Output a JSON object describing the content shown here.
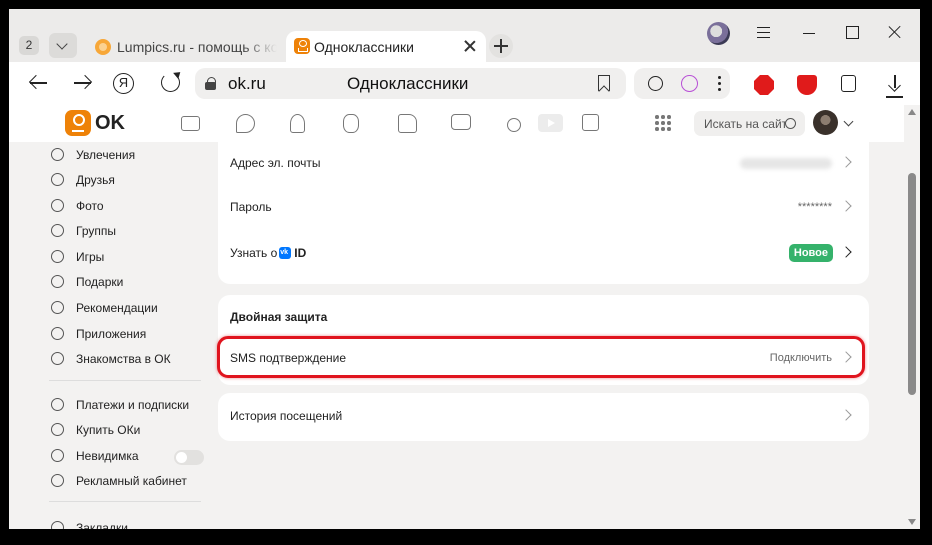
{
  "browser": {
    "tab_count": "2",
    "tabs": [
      {
        "title": "Lumpics.ru - помощь с компьютером",
        "active": false
      },
      {
        "title": "Одноклассники",
        "active": true
      }
    ],
    "address": {
      "url": "ok.ru",
      "page_title": "Одноклассники"
    }
  },
  "ok_header": {
    "logo_text": "OK",
    "search_placeholder": "Искать на сайте"
  },
  "sidebar": {
    "items": [
      {
        "label": "Увлечения",
        "icon": "hobbies-icon"
      },
      {
        "label": "Друзья",
        "icon": "friends-icon"
      },
      {
        "label": "Фото",
        "icon": "photo-icon"
      },
      {
        "label": "Группы",
        "icon": "groups-icon"
      },
      {
        "label": "Игры",
        "icon": "games-icon"
      },
      {
        "label": "Подарки",
        "icon": "gifts-icon"
      },
      {
        "label": "Рекомендации",
        "icon": "recommendations-icon"
      },
      {
        "label": "Приложения",
        "icon": "apps-icon"
      },
      {
        "label": "Знакомства в ОК",
        "icon": "dating-icon"
      }
    ],
    "items2": [
      {
        "label": "Платежи и подписки",
        "icon": "payments-icon"
      },
      {
        "label": "Купить ОКи",
        "icon": "coins-icon"
      },
      {
        "label": "Невидимка",
        "icon": "invisible-icon",
        "toggle": false
      },
      {
        "label": "Рекламный кабинет",
        "icon": "ads-icon"
      }
    ],
    "items3": [
      {
        "label": "Закладки",
        "icon": "bookmarks-icon"
      }
    ]
  },
  "settings": {
    "email_label": "Адрес эл. почты",
    "password_label": "Пароль",
    "password_value": "********",
    "vkid_label_prefix": "Узнать о",
    "vkid_label_suffix": "ID",
    "vkid_badge": "Новое",
    "two_factor_heading": "Двойная защита",
    "sms_label": "SMS подтверждение",
    "sms_value": "Подключить",
    "history_label": "История посещений"
  },
  "colors": {
    "ok_orange": "#ee8208",
    "highlight_red": "#e0141e",
    "badge_green": "#35b26b"
  }
}
